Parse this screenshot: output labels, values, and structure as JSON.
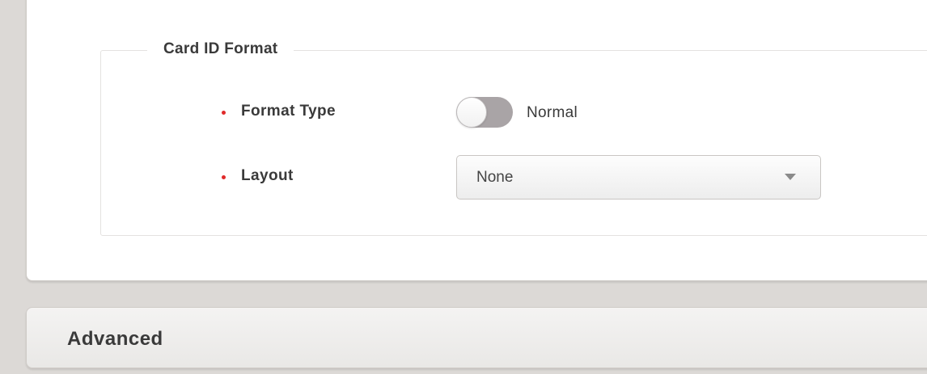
{
  "card_id_format": {
    "legend": "Card ID Format",
    "format_type": {
      "label": "Format Type",
      "toggle_on": false,
      "value_text": "Normal"
    },
    "layout": {
      "label": "Layout",
      "selected": "None"
    }
  },
  "advanced": {
    "title": "Advanced"
  },
  "colors": {
    "required_marker": "#e02a2a",
    "page_background": "#dcd9d6",
    "toggle_track": "#a9a4a6"
  }
}
